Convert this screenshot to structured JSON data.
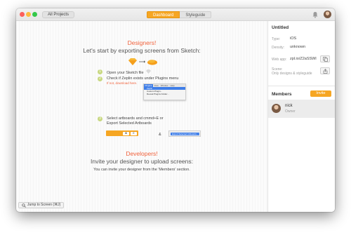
{
  "toolbar": {
    "all_projects": "All Projects",
    "tabs": [
      {
        "label": "Dashboard",
        "active": true
      },
      {
        "label": "Styleguide",
        "active": false
      }
    ],
    "bell_icon": "bell-icon",
    "avatar_icon": "user-avatar"
  },
  "main": {
    "designers_heading": "Designers!",
    "designers_subheading": "Let's start by exporting screens from Sketch:",
    "steps": [
      {
        "num": "1",
        "text": "Open your Sketch file"
      },
      {
        "num": "2",
        "text": "Check if Zeplin exists under Plugins menu",
        "sub": "If not, download here."
      },
      {
        "num": "3",
        "text": "Select artboards and cmmd+E or",
        "text2": "Export Selected Artboards"
      }
    ],
    "menu_mock": {
      "bar": [
        "Plugins",
        "View",
        "Window",
        "Help"
      ],
      "rows": [
        "Zeplin",
        "Custom Plugin...",
        "Reveal Plugins Folder..."
      ]
    },
    "shortcut_keys": [
      "⌘",
      "E"
    ],
    "amp": "&",
    "export_label": "Export Selected Artboards... ⌘E",
    "developers_heading": "Developers!",
    "developers_subheading": "Invite your designer to upload screens:",
    "developers_caption": "You can invite your designer from the 'Members' section.",
    "jump_label": "Jump to Screen (⌘J)"
  },
  "sidebar": {
    "title": "Untitled",
    "fields": [
      {
        "label": "Type:",
        "value": "iOS"
      },
      {
        "label": "Density:",
        "value": "unknown"
      },
      {
        "label": "Web app:",
        "value": "zpl.io/Z2aSSWl"
      },
      {
        "label": "Scene:",
        "value": "Only designs & styleguide"
      }
    ],
    "members_title": "Members",
    "invite_label": "Invite",
    "member": {
      "name": "nick",
      "role": "Owner"
    }
  },
  "colors": {
    "accent": "#f6a623",
    "heading_orange": "#f0623c",
    "step_green": "#c8d880",
    "selection_blue": "#3f7ee8"
  }
}
